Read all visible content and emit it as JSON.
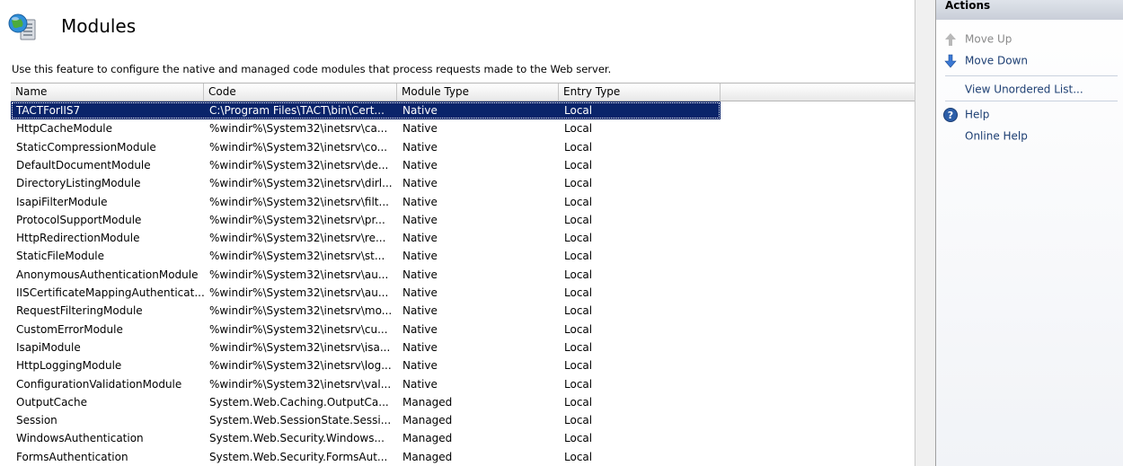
{
  "page": {
    "title": "Modules",
    "description": "Use this feature to configure the native and managed code modules that process requests made to the Web server."
  },
  "table": {
    "columns": [
      "Name",
      "Code",
      "Module Type",
      "Entry Type"
    ],
    "rows": [
      {
        "name": "TACTForIIS7",
        "code": "C:\\Program Files\\TACT\\bin\\Cert...",
        "type": "Native",
        "entry": "Local",
        "selected": true
      },
      {
        "name": "HttpCacheModule",
        "code": "%windir%\\System32\\inetsrv\\ca...",
        "type": "Native",
        "entry": "Local"
      },
      {
        "name": "StaticCompressionModule",
        "code": "%windir%\\System32\\inetsrv\\co...",
        "type": "Native",
        "entry": "Local"
      },
      {
        "name": "DefaultDocumentModule",
        "code": "%windir%\\System32\\inetsrv\\de...",
        "type": "Native",
        "entry": "Local"
      },
      {
        "name": "DirectoryListingModule",
        "code": "%windir%\\System32\\inetsrv\\dirl...",
        "type": "Native",
        "entry": "Local"
      },
      {
        "name": "IsapiFilterModule",
        "code": "%windir%\\System32\\inetsrv\\filt...",
        "type": "Native",
        "entry": "Local"
      },
      {
        "name": "ProtocolSupportModule",
        "code": "%windir%\\System32\\inetsrv\\pr...",
        "type": "Native",
        "entry": "Local"
      },
      {
        "name": "HttpRedirectionModule",
        "code": "%windir%\\System32\\inetsrv\\re...",
        "type": "Native",
        "entry": "Local"
      },
      {
        "name": "StaticFileModule",
        "code": "%windir%\\System32\\inetsrv\\st...",
        "type": "Native",
        "entry": "Local"
      },
      {
        "name": "AnonymousAuthenticationModule",
        "code": "%windir%\\System32\\inetsrv\\au...",
        "type": "Native",
        "entry": "Local"
      },
      {
        "name": "IISCertificateMappingAuthenticat...",
        "code": "%windir%\\System32\\inetsrv\\au...",
        "type": "Native",
        "entry": "Local"
      },
      {
        "name": "RequestFilteringModule",
        "code": "%windir%\\System32\\inetsrv\\mo...",
        "type": "Native",
        "entry": "Local"
      },
      {
        "name": "CustomErrorModule",
        "code": "%windir%\\System32\\inetsrv\\cu...",
        "type": "Native",
        "entry": "Local"
      },
      {
        "name": "IsapiModule",
        "code": "%windir%\\System32\\inetsrv\\isa...",
        "type": "Native",
        "entry": "Local"
      },
      {
        "name": "HttpLoggingModule",
        "code": "%windir%\\System32\\inetsrv\\log...",
        "type": "Native",
        "entry": "Local"
      },
      {
        "name": "ConfigurationValidationModule",
        "code": "%windir%\\System32\\inetsrv\\val...",
        "type": "Native",
        "entry": "Local"
      },
      {
        "name": "OutputCache",
        "code": "System.Web.Caching.OutputCa...",
        "type": "Managed",
        "entry": "Local"
      },
      {
        "name": "Session",
        "code": "System.Web.SessionState.Sessi...",
        "type": "Managed",
        "entry": "Local"
      },
      {
        "name": "WindowsAuthentication",
        "code": "System.Web.Security.Windows...",
        "type": "Managed",
        "entry": "Local"
      },
      {
        "name": "FormsAuthentication",
        "code": "System.Web.Security.FormsAut...",
        "type": "Managed",
        "entry": "Local"
      }
    ]
  },
  "actions": {
    "header": "Actions",
    "move_up": "Move Up",
    "move_down": "Move Down",
    "view_unordered": "View Unordered List...",
    "help": "Help",
    "online_help": "Online Help"
  },
  "colors": {
    "selection": "#0a246a",
    "link": "#1d3f73",
    "disabled": "#8a8a8a"
  }
}
